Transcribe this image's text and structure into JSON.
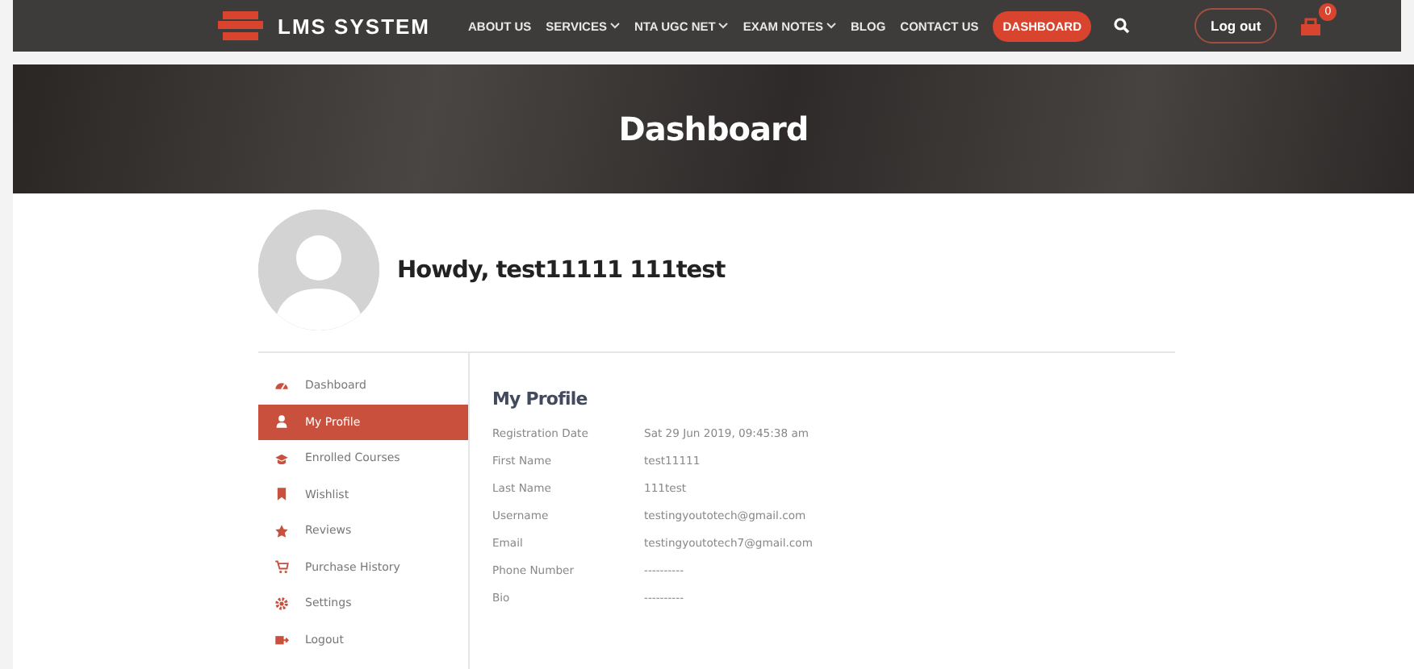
{
  "brand": {
    "name": "LMS SYSTEM"
  },
  "nav": [
    {
      "label": "ABOUT US",
      "dropdown": false,
      "selected": false
    },
    {
      "label": "SERVICES",
      "dropdown": true,
      "selected": false
    },
    {
      "label": "NTA UGC NET",
      "dropdown": true,
      "selected": false
    },
    {
      "label": "EXAM NOTES",
      "dropdown": true,
      "selected": false
    },
    {
      "label": "BLOG",
      "dropdown": false,
      "selected": false
    },
    {
      "label": "CONTACT US",
      "dropdown": false,
      "selected": false
    },
    {
      "label": "DASHBOARD",
      "dropdown": false,
      "selected": true
    }
  ],
  "logout": {
    "label": "Log out"
  },
  "cart": {
    "count": "0"
  },
  "hero": {
    "title": "Dashboard"
  },
  "greeting": "Howdy, test11111 111test",
  "sidebar": [
    {
      "label": "Dashboard",
      "selected": false
    },
    {
      "label": "My Profile",
      "selected": true
    },
    {
      "label": "Enrolled Courses",
      "selected": false
    },
    {
      "label": "Wishlist",
      "selected": false
    },
    {
      "label": "Reviews",
      "selected": false
    },
    {
      "label": "Purchase History",
      "selected": false
    },
    {
      "label": "Settings",
      "selected": false
    },
    {
      "label": "Logout",
      "selected": false
    }
  ],
  "profile": {
    "title": "My Profile",
    "fields": [
      {
        "label": "Registration Date",
        "value": "Sat 29 Jun 2019, 09:45:38 am"
      },
      {
        "label": "First Name",
        "value": "test11111"
      },
      {
        "label": "Last Name",
        "value": "111test"
      },
      {
        "label": "Username",
        "value": "testingyoutotech@gmail.com"
      },
      {
        "label": "Email",
        "value": "testingyoutotech7@gmail.com"
      },
      {
        "label": "Phone Number",
        "value": "----------"
      },
      {
        "label": "Bio",
        "value": "----------"
      }
    ]
  }
}
